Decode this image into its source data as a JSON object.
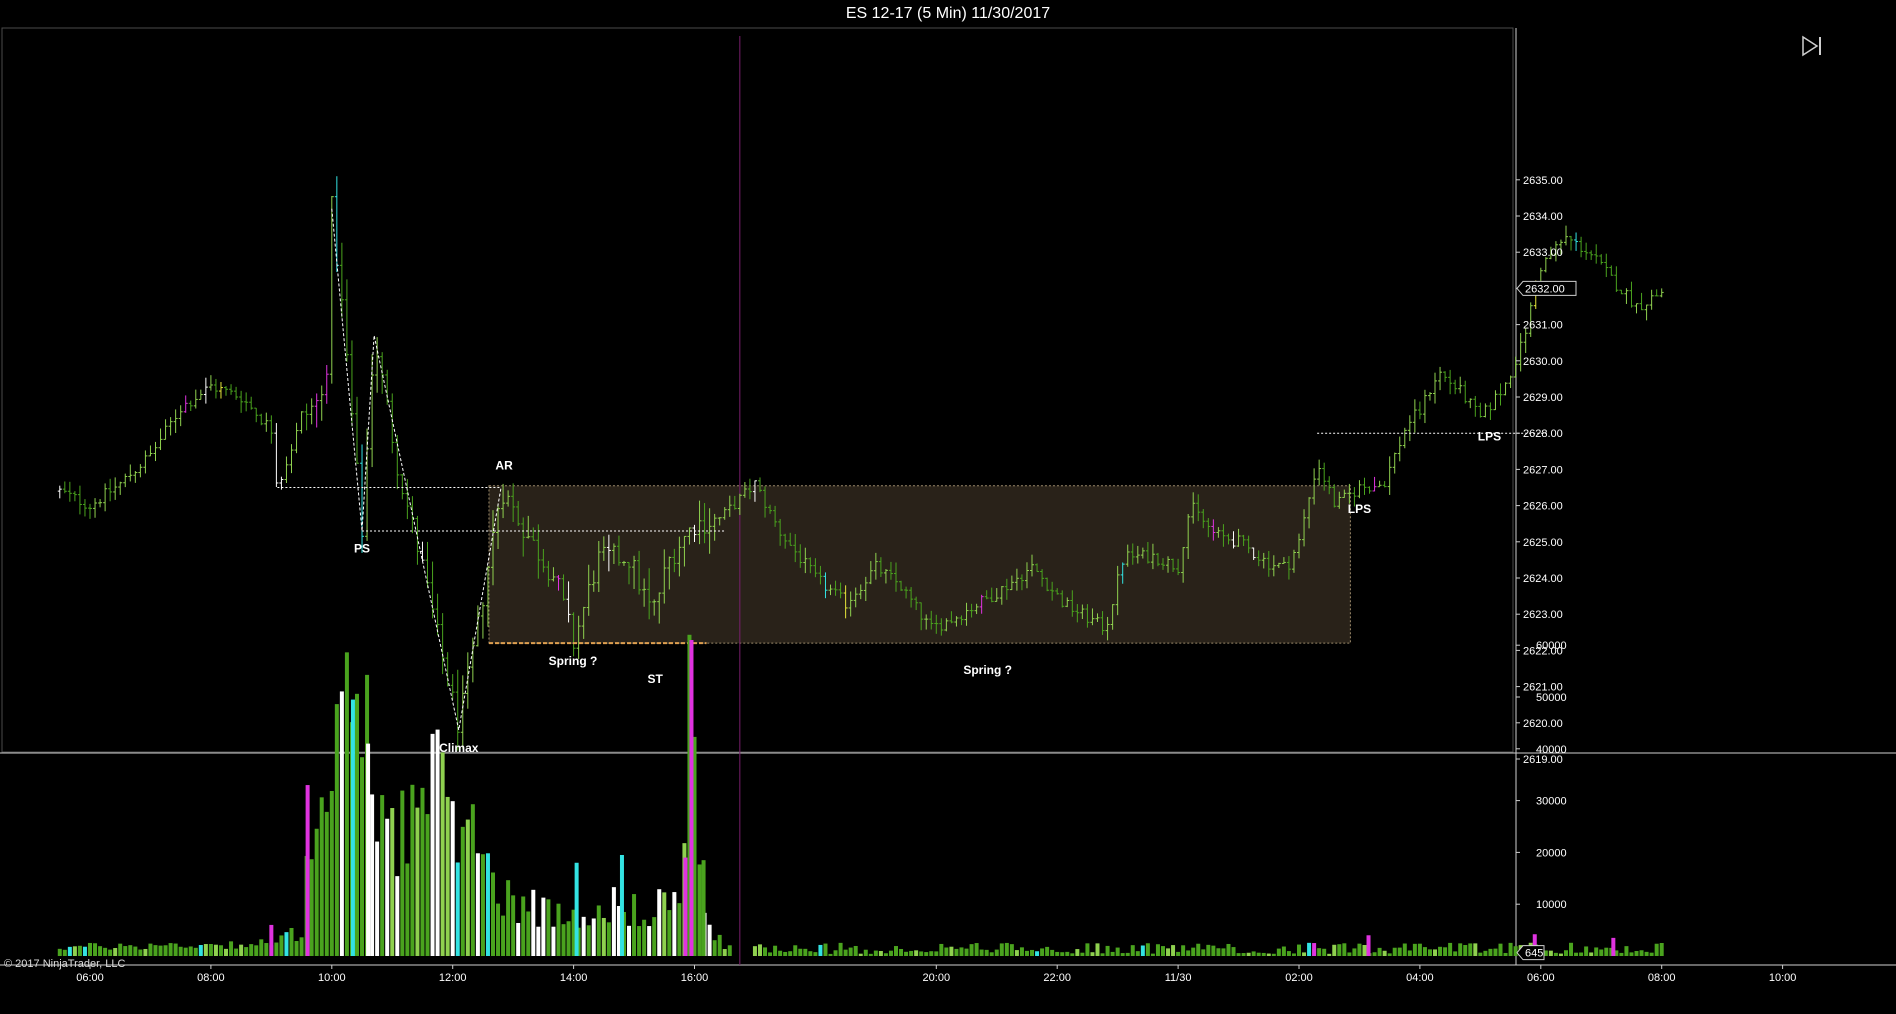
{
  "window": {
    "title": "ES 12-17 (5 Min)  11/30/2017"
  },
  "copyright": "© 2017 NinjaTrader, LLC",
  "colors": {
    "background": "#000000",
    "bar_green": "#4aa31e",
    "bar_lightgreen": "#8fd14f",
    "bar_white": "#ffffff",
    "bar_cyan": "#33e3e3",
    "bar_magenta": "#e033e0",
    "bar_yellow": "#e6e63a",
    "range_fill": "#2e261c",
    "range_border": "#9c8a6a",
    "level_line": "#ffffff",
    "session_line": "#7a1f6e",
    "support_dash": "#e0a050"
  },
  "chart_data": [
    {
      "type": "ohlc",
      "name": "price-panel",
      "ylim": [
        2618.8,
        2635.2
      ],
      "y_ticks": [
        "2619.00",
        "2620.00",
        "2621.00",
        "2622.00",
        "2623.00",
        "2624.00",
        "2625.00",
        "2626.00",
        "2627.00",
        "2628.00",
        "2629.00",
        "2630.00",
        "2631.00",
        "2632.00",
        "2633.00",
        "2634.00",
        "2635.00"
      ],
      "y_tick_values": [
        2619,
        2620,
        2621,
        2622,
        2623,
        2624,
        2625,
        2626,
        2627,
        2628,
        2629,
        2630,
        2631,
        2632,
        2633,
        2634,
        2635
      ],
      "current_price_label": "2632.00",
      "current_price": 2632.0,
      "x_hours": [
        5.4,
        10.0,
        16.0,
        20.0,
        24.0,
        28.0,
        32.0,
        34.0
      ],
      "x_ticks": [
        {
          "label": "06:00",
          "h": 6
        },
        {
          "label": "08:00",
          "h": 8
        },
        {
          "label": "10:00",
          "h": 10
        },
        {
          "label": "12:00",
          "h": 12
        },
        {
          "label": "14:00",
          "h": 14
        },
        {
          "label": "16:00",
          "h": 16
        },
        {
          "label": "20:00",
          "h": 20
        },
        {
          "label": "22:00",
          "h": 22
        },
        {
          "label": "11/30",
          "h": 24
        },
        {
          "label": "02:00",
          "h": 26
        },
        {
          "label": "04:00",
          "h": 28
        },
        {
          "label": "06:00",
          "h": 30
        },
        {
          "label": "08:00",
          "h": 32
        },
        {
          "label": "10:00",
          "h": 34
        }
      ],
      "x_range_hours": [
        5.4,
        34.0
      ],
      "session_break_h": 16.75,
      "price_path": [
        [
          5.5,
          2626.4
        ],
        [
          6.0,
          2626.0
        ],
        [
          6.5,
          2626.6
        ],
        [
          7.0,
          2627.4
        ],
        [
          7.5,
          2628.7
        ],
        [
          8.0,
          2629.3
        ],
        [
          8.5,
          2629.0
        ],
        [
          9.0,
          2628.1
        ],
        [
          9.1,
          2626.5
        ],
        [
          9.5,
          2628.4
        ],
        [
          9.9,
          2629.1
        ],
        [
          10.0,
          2634.2
        ],
        [
          10.2,
          2631.0
        ],
        [
          10.5,
          2625.3
        ],
        [
          10.7,
          2630.7
        ],
        [
          11.1,
          2627.0
        ],
        [
          11.5,
          2624.3
        ],
        [
          11.8,
          2622.0
        ],
        [
          12.1,
          2619.9
        ],
        [
          12.4,
          2622.5
        ],
        [
          12.8,
          2626.5
        ],
        [
          13.3,
          2625.0
        ],
        [
          13.7,
          2624.0
        ],
        [
          14.0,
          2622.2
        ],
        [
          14.4,
          2624.5
        ],
        [
          14.9,
          2624.6
        ],
        [
          15.3,
          2623.0
        ],
        [
          15.6,
          2624.6
        ],
        [
          16.0,
          2625.5
        ],
        [
          16.4,
          2625.6
        ],
        [
          17.0,
          2626.6
        ],
        [
          17.4,
          2625.3
        ],
        [
          18.0,
          2624.0
        ],
        [
          18.5,
          2623.3
        ],
        [
          19.0,
          2624.3
        ],
        [
          19.4,
          2623.8
        ],
        [
          19.9,
          2622.6
        ],
        [
          20.3,
          2622.9
        ],
        [
          21.0,
          2623.6
        ],
        [
          21.6,
          2624.3
        ],
        [
          22.1,
          2623.3
        ],
        [
          22.8,
          2622.6
        ],
        [
          23.1,
          2624.6
        ],
        [
          23.6,
          2624.6
        ],
        [
          24.0,
          2624.3
        ],
        [
          24.2,
          2626.0
        ],
        [
          24.6,
          2625.2
        ],
        [
          25.0,
          2625.0
        ],
        [
          25.5,
          2624.4
        ],
        [
          25.8,
          2624.3
        ],
        [
          26.0,
          2625.0
        ],
        [
          26.3,
          2627.2
        ],
        [
          26.6,
          2626.0
        ],
        [
          27.0,
          2626.5
        ],
        [
          27.4,
          2626.6
        ],
        [
          27.8,
          2628.3
        ],
        [
          28.0,
          2628.6
        ],
        [
          28.3,
          2629.7
        ],
        [
          28.7,
          2629.1
        ],
        [
          29.0,
          2628.4
        ],
        [
          29.4,
          2629.3
        ],
        [
          29.7,
          2630.5
        ],
        [
          30.0,
          2632.6
        ],
        [
          30.4,
          2633.4
        ],
        [
          30.8,
          2633.0
        ],
        [
          31.2,
          2632.2
        ],
        [
          31.6,
          2631.5
        ],
        [
          32.0,
          2631.9
        ]
      ],
      "wyckoff_path": [
        [
          10.0,
          2634.2
        ],
        [
          10.5,
          2625.3
        ],
        [
          10.7,
          2630.7
        ],
        [
          12.1,
          2619.8
        ],
        [
          12.8,
          2626.5
        ]
      ],
      "trading_range": {
        "x0_h": 12.6,
        "x1_h": 26.85,
        "top": 2626.55,
        "bottom": 2622.2
      },
      "levels": [
        {
          "y": 2626.5,
          "x0_h": 9.1,
          "x1_h": 12.8
        },
        {
          "y": 2625.3,
          "x0_h": 10.5,
          "x1_h": 16.5
        },
        {
          "y": 2628.0,
          "x0_h": 26.3,
          "x1_h": 30.1
        }
      ],
      "support_dash": {
        "y": 2622.2,
        "x0_h": 12.6,
        "x1_h": 16.2
      },
      "annotations": [
        {
          "text": "AR",
          "h": 12.85,
          "y": 2627.0
        },
        {
          "text": "PS",
          "h": 10.5,
          "y": 2624.7
        },
        {
          "text": "Climax",
          "h": 12.1,
          "y": 2619.2
        },
        {
          "text": "Spring ?",
          "h": 13.99,
          "y": 2621.6
        },
        {
          "text": "ST",
          "h": 15.35,
          "y": 2621.1
        },
        {
          "text": "Spring ?",
          "h": 20.85,
          "y": 2621.35
        },
        {
          "text": "LPS",
          "h": 27.0,
          "y": 2625.8
        },
        {
          "text": "LPS",
          "h": 29.15,
          "y": 2627.8
        }
      ]
    },
    {
      "type": "bar",
      "name": "volume-panel",
      "ylim": [
        0,
        68000
      ],
      "y_ticks": [
        "10000",
        "20000",
        "30000",
        "40000",
        "50000",
        "60000"
      ],
      "y_tick_values": [
        10000,
        20000,
        30000,
        40000,
        50000,
        60000
      ],
      "current_volume_label": "645",
      "current_volume": 645,
      "volume_path": [
        [
          5.5,
          1800
        ],
        [
          9.0,
          2500
        ],
        [
          9.5,
          5000
        ],
        [
          9.55,
          33000
        ],
        [
          9.8,
          28000
        ],
        [
          10.0,
          35000
        ],
        [
          10.3,
          49000
        ],
        [
          10.6,
          42000
        ],
        [
          11.0,
          27000
        ],
        [
          11.5,
          29000
        ],
        [
          11.8,
          34000
        ],
        [
          12.1,
          31000
        ],
        [
          12.4,
          22000
        ],
        [
          12.7,
          15000
        ],
        [
          13.0,
          12000
        ],
        [
          13.5,
          9000
        ],
        [
          14.0,
          8500
        ],
        [
          14.5,
          11000
        ],
        [
          15.0,
          9000
        ],
        [
          15.5,
          11000
        ],
        [
          15.8,
          12000
        ],
        [
          15.95,
          60000
        ],
        [
          16.1,
          17000
        ],
        [
          16.3,
          4000
        ],
        [
          16.6,
          1500
        ],
        [
          17.0,
          900
        ],
        [
          32.0,
          1500
        ]
      ],
      "notable_bars": [
        {
          "h": 9.6,
          "v": 33000,
          "c": "magenta"
        },
        {
          "h": 10.35,
          "v": 49500,
          "c": "cyan"
        },
        {
          "h": 10.6,
          "v": 41000,
          "c": "white"
        },
        {
          "h": 14.05,
          "v": 18000,
          "c": "cyan"
        },
        {
          "h": 14.8,
          "v": 19500,
          "c": "cyan"
        },
        {
          "h": 15.95,
          "v": 61000,
          "c": "magenta"
        },
        {
          "h": 15.85,
          "v": 19000,
          "c": "magenta"
        },
        {
          "h": 16.15,
          "v": 18500,
          "c": "green"
        },
        {
          "h": 9.0,
          "v": 6000,
          "c": "magenta"
        },
        {
          "h": 26.25,
          "v": 2500,
          "c": "magenta"
        },
        {
          "h": 27.15,
          "v": 4000,
          "c": "magenta"
        },
        {
          "h": 29.9,
          "v": 4200,
          "c": "magenta"
        },
        {
          "h": 31.2,
          "v": 3500,
          "c": "magenta"
        }
      ]
    }
  ]
}
